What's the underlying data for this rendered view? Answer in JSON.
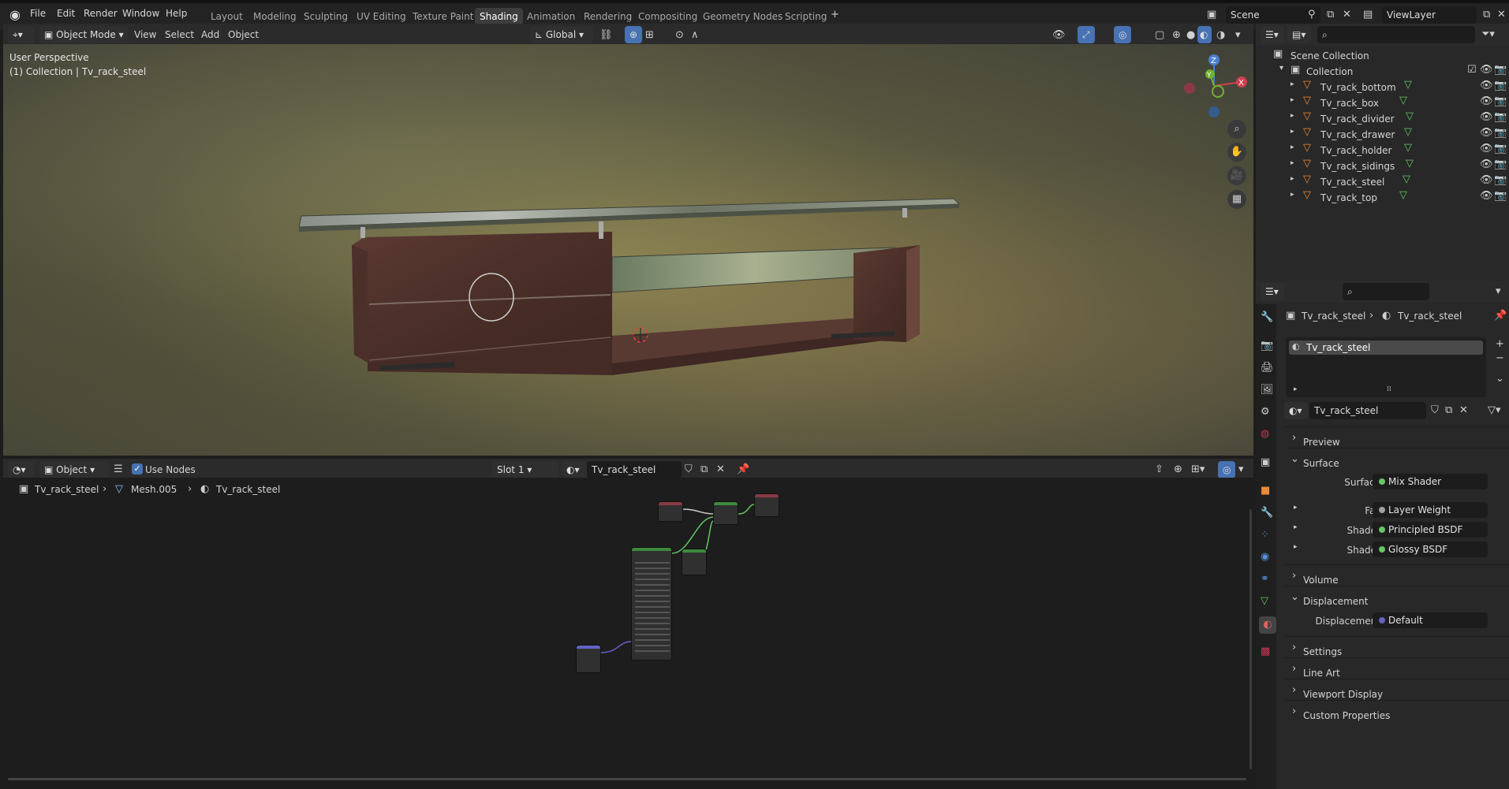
{
  "menu": [
    "File",
    "Edit",
    "Render",
    "Window",
    "Help"
  ],
  "workspaces": [
    "Layout",
    "Modeling",
    "Sculpting",
    "UV Editing",
    "Texture Paint",
    "Shading",
    "Animation",
    "Rendering",
    "Compositing",
    "Geometry Nodes",
    "Scripting"
  ],
  "active_workspace": "Shading",
  "scene": {
    "name": "Scene",
    "view_layer": "ViewLayer"
  },
  "viewport_header": {
    "mode": "Object Mode",
    "menus": [
      "View",
      "Select",
      "Add",
      "Object"
    ],
    "orientation": "Global"
  },
  "viewport": {
    "perspective": "User Perspective",
    "collection_info": "(1) Collection | Tv_rack_steel",
    "gizmo": {
      "z": "Z",
      "y": "Y",
      "x": "X"
    }
  },
  "node_header": {
    "mode": "Object",
    "use_nodes": "Use Nodes",
    "slot": "Slot 1",
    "material": "Tv_rack_steel"
  },
  "node_breadcrumb": [
    "Tv_rack_steel",
    "Mesh.005",
    "Tv_rack_steel"
  ],
  "outliner": {
    "scene_collection": "Scene Collection",
    "collection": "Collection",
    "items": [
      "Tv_rack_bottom",
      "Tv_rack_box",
      "Tv_rack_divider",
      "Tv_rack_drawer",
      "Tv_rack_holder",
      "Tv_rack_sidings",
      "Tv_rack_steel",
      "Tv_rack_top"
    ]
  },
  "properties": {
    "breadcrumb": [
      "Tv_rack_steel",
      "Tv_rack_steel"
    ],
    "slot_item": "Tv_rack_steel",
    "material_name": "Tv_rack_steel",
    "sections": {
      "preview": "Preview",
      "surface": "Surface",
      "volume": "Volume",
      "displacement": "Displacement",
      "settings": "Settings",
      "line_art": "Line Art",
      "viewport_display": "Viewport Display",
      "custom_properties": "Custom Properties"
    },
    "surface": {
      "label": "Surface",
      "value": "Mix Shader"
    },
    "fac": {
      "label": "Fac",
      "value": "Layer Weight"
    },
    "shader1": {
      "label": "Shader",
      "value": "Principled BSDF"
    },
    "shader2": {
      "label": "Shader",
      "value": "Glossy BSDF"
    },
    "displacement_field": {
      "label": "Displacement",
      "value": "Default"
    }
  },
  "colors": {
    "accent": "#4772b3",
    "shader_socket": "#63c763",
    "vector_socket": "#6363c7",
    "node_bg": "#303030"
  }
}
